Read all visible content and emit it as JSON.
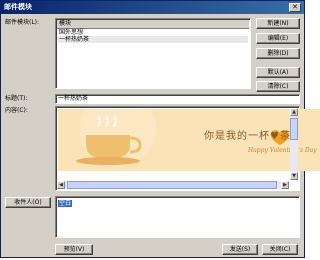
{
  "window": {
    "title": "邮件模块",
    "close_glyph": "✕"
  },
  "labels": {
    "module": "邮件模块(L):",
    "subject": "标题(T):",
    "content": "内容(C):"
  },
  "module_list": {
    "header": "模块",
    "items": [
      "国外思想",
      "一杯热奶茶"
    ],
    "selected_index": 1
  },
  "side_buttons": {
    "new": "新建(N)",
    "edit": "编辑(E)",
    "delete": "删除(D)",
    "default": "默认(A)",
    "clear": "清除(C)"
  },
  "subject_value": "一杯热奶茶",
  "content_banner": {
    "main_text": "你是我的一杯♥茶",
    "sub_text": "Happy Valentine's Day",
    "colors": {
      "background": "#fbe3b8",
      "cup": "#f0c070",
      "heart": "#f0a020",
      "text": "#8a5a2a"
    }
  },
  "recipient": {
    "button": "收件人(O)",
    "value": "空白"
  },
  "bottom_buttons": {
    "preview": "预览(V)",
    "send": "发送(S)",
    "close": "关闭(C)"
  }
}
